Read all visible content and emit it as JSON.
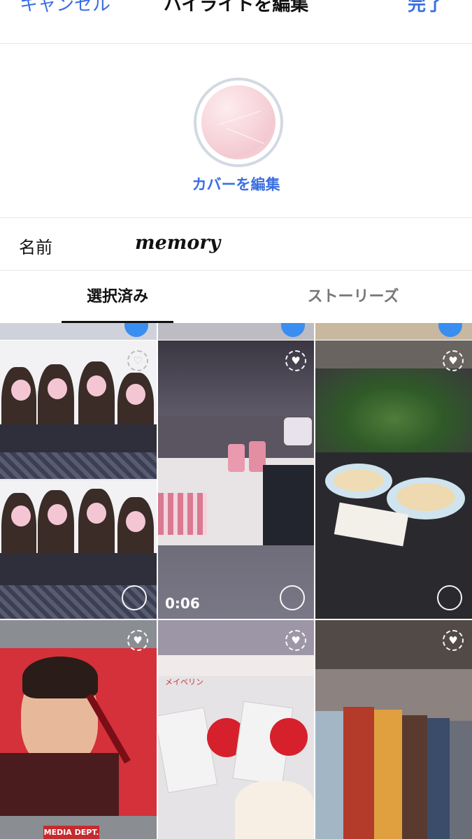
{
  "header": {
    "cancel_label": "キャンセル",
    "title": "ハイライトを編集",
    "done_label": "完了"
  },
  "cover": {
    "edit_label": "カバーを編集"
  },
  "name_field": {
    "label": "名前",
    "value": "memory"
  },
  "tabs": [
    {
      "label": "選択済み",
      "active": true
    },
    {
      "label": "ストーリーズ",
      "active": false
    }
  ],
  "grid": {
    "tiles": [
      {
        "name": "purikura-photo",
        "selected": false
      },
      {
        "name": "drinks-video",
        "selected": false,
        "duration": "0:06"
      },
      {
        "name": "ramen-shop-photo",
        "selected": false
      },
      {
        "name": "billboard-photo",
        "selected": false,
        "caption": "MEDIA DEPT."
      },
      {
        "name": "maybelline-goods-photo",
        "selected": false,
        "caption": "メイベリン"
      },
      {
        "name": "timeless-mural-photo",
        "selected": false
      }
    ]
  },
  "colors": {
    "accent": "#3a6fe0",
    "select_dot": "#3a8ef0"
  },
  "icons": [
    "highlight-ring-icon",
    "select-circle-icon"
  ]
}
